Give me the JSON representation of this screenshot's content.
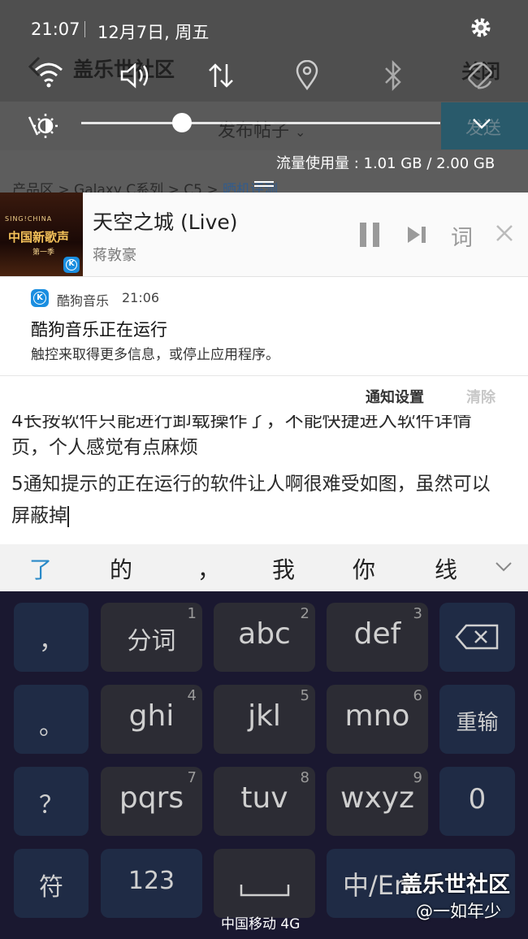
{
  "status": {
    "time": "21:07",
    "date": "12月7日, 周五"
  },
  "app_header": {
    "back_icon": "back-arrow-icon",
    "title": "盖乐世社区",
    "close_label": "关闭"
  },
  "post_bar": {
    "publish_label": "发布帖子",
    "send_label": "发送"
  },
  "data_usage": "流量使用量 : 1.01 GB / 2.00 GB",
  "breadcrumb": {
    "base": "产品区 > Galaxy C系列 > C5 > ",
    "current": "晒机评测"
  },
  "media": {
    "album_art": {
      "line1": "SING!CHINA",
      "line2": "中国新歌声",
      "line3": "第一季"
    },
    "title": "天空之城 (Live)",
    "artist": "蒋敦豪",
    "lyric_label": "词"
  },
  "notification": {
    "app_name": "酷狗音乐",
    "time": "21:06",
    "title": "酷狗音乐正在运行",
    "body": "触控来取得更多信息，或停止应用程序。",
    "settings_label": "通知设置",
    "clear_label": "清除"
  },
  "post_text": {
    "line_partial": "4长按软件只能进行卸载操作了，不能快捷进入软件详情",
    "line1": "页，个人感觉有点麻烦",
    "line2": "5通知提示的正在运行的软件让人啊很难受如图，虽然可以",
    "line3": "屏蔽掉"
  },
  "candidates": [
    "了",
    "的",
    "，",
    "我",
    "你",
    "线"
  ],
  "keyboard": {
    "rows": [
      {
        "side": "，",
        "keys": [
          {
            "label": "分词",
            "num": "1"
          },
          {
            "label": "abc",
            "num": "2"
          },
          {
            "label": "def",
            "num": "3"
          }
        ],
        "right": "⌫"
      },
      {
        "side": "。",
        "keys": [
          {
            "label": "ghi",
            "num": "4"
          },
          {
            "label": "jkl",
            "num": "5"
          },
          {
            "label": "mno",
            "num": "6"
          }
        ],
        "right": "重输"
      },
      {
        "side": "？",
        "keys": [
          {
            "label": "pqrs",
            "num": "7"
          },
          {
            "label": "tuv",
            "num": "8"
          },
          {
            "label": "wxyz",
            "num": "9"
          }
        ],
        "right": "0"
      }
    ],
    "bottom": {
      "symbol": "符",
      "numbers": "123",
      "space": "⎵",
      "lang": "中/En"
    }
  },
  "carrier": "中国移动 4G",
  "watermark": {
    "line1": "盖乐世社区",
    "line2": "@一如年少"
  },
  "brightness_level": 0.28,
  "colors": {
    "accent": "#0099cc",
    "link": "#2f6db5",
    "keyboard_bg": "#1a1830"
  }
}
